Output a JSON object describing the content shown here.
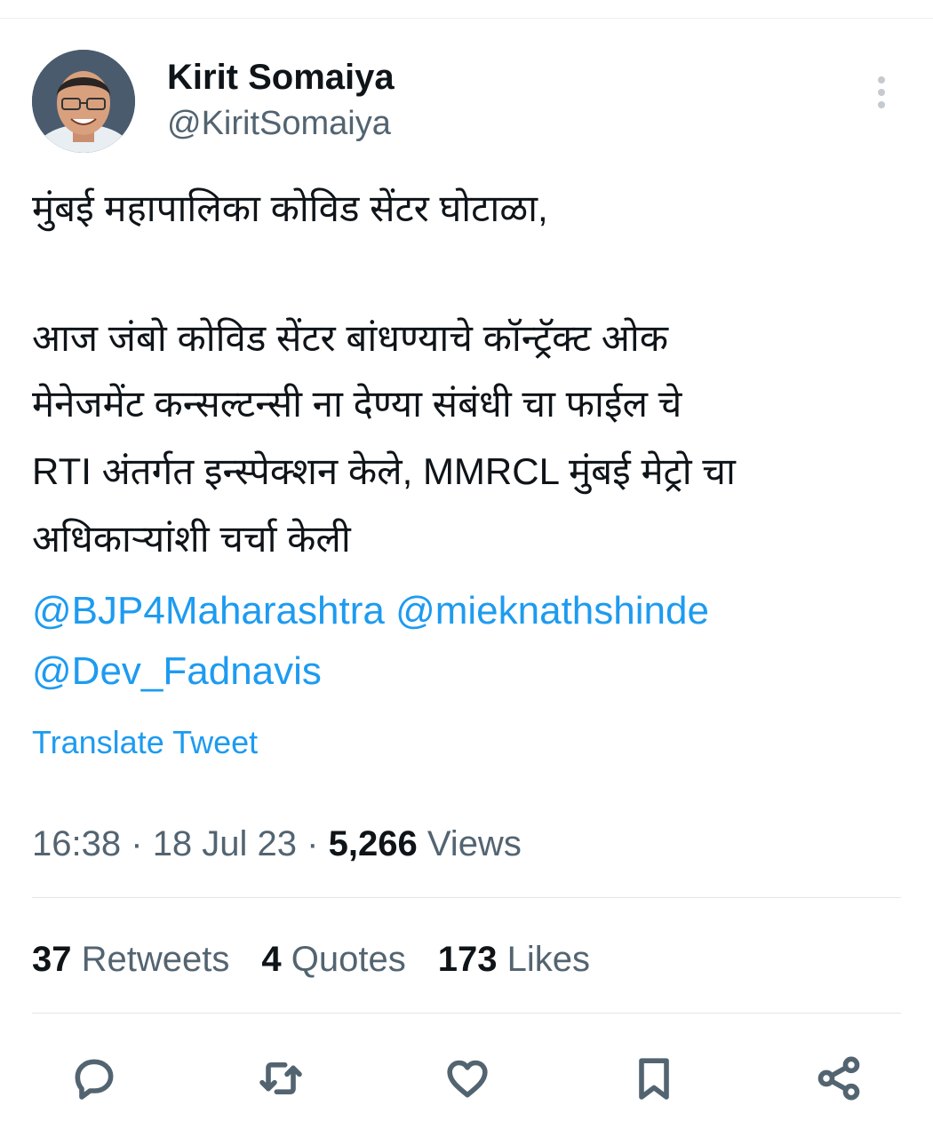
{
  "author": {
    "display_name": "Kirit Somaiya",
    "handle": "@KiritSomaiya",
    "avatar_icon": "profile-photo"
  },
  "tweet": {
    "line_1": "मुंबई महापालिका कोविड सेंटर घोटाळा,",
    "line_2": "आज जंबो कोविड सेंटर बांधण्याचे कॉन्ट्रॅक्ट ओक",
    "line_3": "मेनेजमेंट कन्सल्टन्सी ना देण्या संबंधी चा फाईल चे",
    "line_4": "RTI अंतर्गत इन्स्पेक्शन केले, MMRCL मुंबई मेट्रो चा",
    "line_5": "अधिकाऱ्यांशी चर्चा केली",
    "mentions": [
      "@BJP4Maharashtra",
      "@mieknathshinde",
      "@Dev_Fadnavis"
    ],
    "translate_label": "Translate Tweet"
  },
  "meta": {
    "time": "16:38",
    "date": "18 Jul 23",
    "views_count": "5,266",
    "views_label": "Views",
    "separator": "·"
  },
  "stats": {
    "retweets_count": "37",
    "retweets_label": "Retweets",
    "quotes_count": "4",
    "quotes_label": "Quotes",
    "likes_count": "173",
    "likes_label": "Likes"
  },
  "actions": [
    "reply-icon",
    "retweet-icon",
    "like-icon",
    "bookmark-icon",
    "share-icon"
  ],
  "colors": {
    "link": "#1d9bf0",
    "text": "#0f1419",
    "secondary": "#536471"
  }
}
